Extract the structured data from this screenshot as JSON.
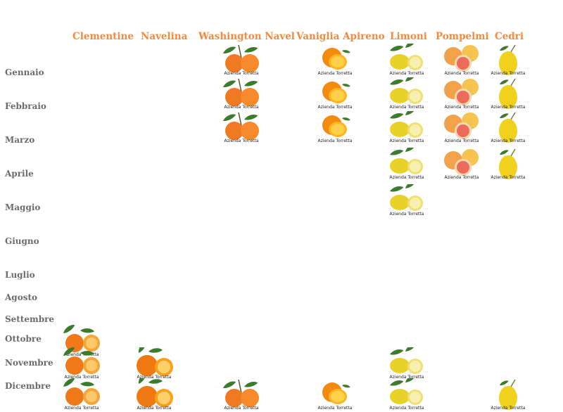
{
  "colors": {
    "header_text": "#f58a3c",
    "month_text": "#6b6b6b",
    "background": "#ffffff"
  },
  "columns": [
    {
      "key": "clementine",
      "label": "Clementine",
      "icon": "clementine-fruit-icon",
      "caption": "Azienda Torretta"
    },
    {
      "key": "navelina",
      "label": "Navelina",
      "icon": "navel-orange-fruit-icon",
      "caption": "Azienda Torretta"
    },
    {
      "key": "washington",
      "label": "Washington Navel",
      "icon": "orange-branch-fruit-icon",
      "caption": "Azienda Torretta"
    },
    {
      "key": "vaniglia",
      "label": "Vaniglia Apireno",
      "icon": "vanilla-orange-fruit-icon",
      "caption": "Azienda Torretta"
    },
    {
      "key": "limoni",
      "label": "Limoni",
      "icon": "lemon-fruit-icon",
      "caption": "Azienda Torretta"
    },
    {
      "key": "pompelmi",
      "label": "Pompelmi",
      "icon": "grapefruit-fruit-icon",
      "caption": "Azienda Torretta"
    },
    {
      "key": "cedri",
      "label": "Cedri",
      "icon": "citron-fruit-icon",
      "caption": "Azienda Torretta"
    }
  ],
  "months": [
    {
      "label": "Gennaio",
      "available": [
        "washington",
        "vaniglia",
        "limoni",
        "pompelmi",
        "cedri"
      ]
    },
    {
      "label": "Febbraio",
      "available": [
        "washington",
        "vaniglia",
        "limoni",
        "pompelmi",
        "cedri"
      ]
    },
    {
      "label": "Marzo",
      "available": [
        "washington",
        "vaniglia",
        "limoni",
        "pompelmi",
        "cedri"
      ]
    },
    {
      "label": "Aprile",
      "available": [
        "limoni",
        "pompelmi",
        "cedri"
      ]
    },
    {
      "label": "Maggio",
      "available": [
        "limoni"
      ]
    },
    {
      "label": "Giugno",
      "available": []
    },
    {
      "label": "Luglio",
      "available": []
    },
    {
      "label": "Agosto",
      "available": []
    },
    {
      "label": "Settembre",
      "available": []
    },
    {
      "label": "Ottobre",
      "available": [
        "clementine"
      ]
    },
    {
      "label": "Novembre",
      "available": [
        "clementine",
        "navelina",
        "limoni"
      ]
    },
    {
      "label": "Dicembre",
      "available": [
        "clementine",
        "navelina",
        "washington",
        "vaniglia",
        "limoni",
        "cedri"
      ]
    }
  ]
}
